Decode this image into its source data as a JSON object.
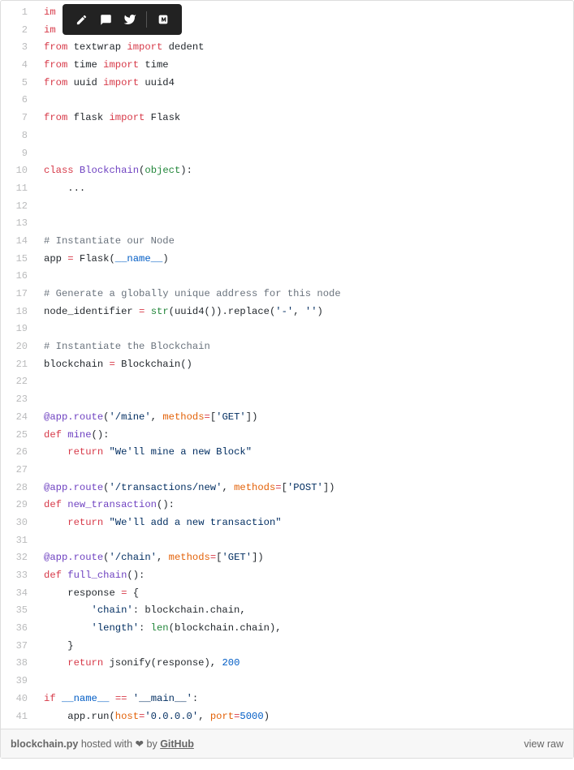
{
  "toolbar": {
    "icons": [
      "pencil-icon",
      "comment-icon",
      "twitter-icon",
      "medium-icon"
    ]
  },
  "code": [
    {
      "n": 1,
      "tokens": [
        [
          "kw",
          "im"
        ]
      ]
    },
    {
      "n": 2,
      "tokens": [
        [
          "kw",
          "im"
        ]
      ]
    },
    {
      "n": 3,
      "tokens": [
        [
          "kw",
          "from"
        ],
        [
          "nm",
          " textwrap "
        ],
        [
          "kw",
          "import"
        ],
        [
          "nm",
          " dedent"
        ]
      ]
    },
    {
      "n": 4,
      "tokens": [
        [
          "kw",
          "from"
        ],
        [
          "nm",
          " time "
        ],
        [
          "kw",
          "import"
        ],
        [
          "nm",
          " time"
        ]
      ]
    },
    {
      "n": 5,
      "tokens": [
        [
          "kw",
          "from"
        ],
        [
          "nm",
          " uuid "
        ],
        [
          "kw",
          "import"
        ],
        [
          "nm",
          " uuid4"
        ]
      ]
    },
    {
      "n": 6,
      "tokens": []
    },
    {
      "n": 7,
      "tokens": [
        [
          "kw",
          "from"
        ],
        [
          "nm",
          " flask "
        ],
        [
          "kw",
          "import"
        ],
        [
          "nm",
          " Flask"
        ]
      ]
    },
    {
      "n": 8,
      "tokens": []
    },
    {
      "n": 9,
      "tokens": []
    },
    {
      "n": 10,
      "tokens": [
        [
          "kw",
          "class"
        ],
        [
          "nm",
          " "
        ],
        [
          "fn",
          "Blockchain"
        ],
        [
          "nm",
          "("
        ],
        [
          "cls",
          "object"
        ],
        [
          "nm",
          "):"
        ]
      ]
    },
    {
      "n": 11,
      "tokens": [
        [
          "nm",
          "    ..."
        ]
      ]
    },
    {
      "n": 12,
      "tokens": []
    },
    {
      "n": 13,
      "tokens": []
    },
    {
      "n": 14,
      "tokens": [
        [
          "cmt",
          "# Instantiate our Node"
        ]
      ]
    },
    {
      "n": 15,
      "tokens": [
        [
          "nm",
          "app "
        ],
        [
          "op",
          "="
        ],
        [
          "nm",
          " Flask("
        ],
        [
          "const",
          "__name__"
        ],
        [
          "nm",
          ")"
        ]
      ]
    },
    {
      "n": 16,
      "tokens": []
    },
    {
      "n": 17,
      "tokens": [
        [
          "cmt",
          "# Generate a globally unique address for this node"
        ]
      ]
    },
    {
      "n": 18,
      "tokens": [
        [
          "nm",
          "node_identifier "
        ],
        [
          "op",
          "="
        ],
        [
          "nm",
          " "
        ],
        [
          "cls",
          "str"
        ],
        [
          "nm",
          "(uuid4()).replace("
        ],
        [
          "str",
          "'-'"
        ],
        [
          "nm",
          ", "
        ],
        [
          "str",
          "''"
        ],
        [
          "nm",
          ")"
        ]
      ]
    },
    {
      "n": 19,
      "tokens": []
    },
    {
      "n": 20,
      "tokens": [
        [
          "cmt",
          "# Instantiate the Blockchain"
        ]
      ]
    },
    {
      "n": 21,
      "tokens": [
        [
          "nm",
          "blockchain "
        ],
        [
          "op",
          "="
        ],
        [
          "nm",
          " Blockchain()"
        ]
      ]
    },
    {
      "n": 22,
      "tokens": []
    },
    {
      "n": 23,
      "tokens": []
    },
    {
      "n": 24,
      "tokens": [
        [
          "dec",
          "@app.route"
        ],
        [
          "nm",
          "("
        ],
        [
          "str",
          "'/mine'"
        ],
        [
          "nm",
          ", "
        ],
        [
          "decarg",
          "methods"
        ],
        [
          "op",
          "="
        ],
        [
          "nm",
          "["
        ],
        [
          "str",
          "'GET'"
        ],
        [
          "nm",
          "])"
        ]
      ]
    },
    {
      "n": 25,
      "tokens": [
        [
          "kw",
          "def"
        ],
        [
          "nm",
          " "
        ],
        [
          "fn",
          "mine"
        ],
        [
          "nm",
          "():"
        ]
      ]
    },
    {
      "n": 26,
      "tokens": [
        [
          "nm",
          "    "
        ],
        [
          "kw",
          "return"
        ],
        [
          "nm",
          " "
        ],
        [
          "str",
          "\"We'll mine a new Block\""
        ]
      ]
    },
    {
      "n": 27,
      "tokens": []
    },
    {
      "n": 28,
      "tokens": [
        [
          "dec",
          "@app.route"
        ],
        [
          "nm",
          "("
        ],
        [
          "str",
          "'/transactions/new'"
        ],
        [
          "nm",
          ", "
        ],
        [
          "decarg",
          "methods"
        ],
        [
          "op",
          "="
        ],
        [
          "nm",
          "["
        ],
        [
          "str",
          "'POST'"
        ],
        [
          "nm",
          "])"
        ]
      ]
    },
    {
      "n": 29,
      "tokens": [
        [
          "kw",
          "def"
        ],
        [
          "nm",
          " "
        ],
        [
          "fn",
          "new_transaction"
        ],
        [
          "nm",
          "():"
        ]
      ]
    },
    {
      "n": 30,
      "tokens": [
        [
          "nm",
          "    "
        ],
        [
          "kw",
          "return"
        ],
        [
          "nm",
          " "
        ],
        [
          "str",
          "\"We'll add a new transaction\""
        ]
      ]
    },
    {
      "n": 31,
      "tokens": []
    },
    {
      "n": 32,
      "tokens": [
        [
          "dec",
          "@app.route"
        ],
        [
          "nm",
          "("
        ],
        [
          "str",
          "'/chain'"
        ],
        [
          "nm",
          ", "
        ],
        [
          "decarg",
          "methods"
        ],
        [
          "op",
          "="
        ],
        [
          "nm",
          "["
        ],
        [
          "str",
          "'GET'"
        ],
        [
          "nm",
          "])"
        ]
      ]
    },
    {
      "n": 33,
      "tokens": [
        [
          "kw",
          "def"
        ],
        [
          "nm",
          " "
        ],
        [
          "fn",
          "full_chain"
        ],
        [
          "nm",
          "():"
        ]
      ]
    },
    {
      "n": 34,
      "tokens": [
        [
          "nm",
          "    response "
        ],
        [
          "op",
          "="
        ],
        [
          "nm",
          " {"
        ]
      ]
    },
    {
      "n": 35,
      "tokens": [
        [
          "nm",
          "        "
        ],
        [
          "str",
          "'chain'"
        ],
        [
          "nm",
          ": blockchain.chain,"
        ]
      ]
    },
    {
      "n": 36,
      "tokens": [
        [
          "nm",
          "        "
        ],
        [
          "str",
          "'length'"
        ],
        [
          "nm",
          ": "
        ],
        [
          "cls",
          "len"
        ],
        [
          "nm",
          "(blockchain.chain),"
        ]
      ]
    },
    {
      "n": 37,
      "tokens": [
        [
          "nm",
          "    }"
        ]
      ]
    },
    {
      "n": 38,
      "tokens": [
        [
          "nm",
          "    "
        ],
        [
          "kw",
          "return"
        ],
        [
          "nm",
          " jsonify(response), "
        ],
        [
          "num",
          "200"
        ]
      ]
    },
    {
      "n": 39,
      "tokens": []
    },
    {
      "n": 40,
      "tokens": [
        [
          "kw",
          "if"
        ],
        [
          "nm",
          " "
        ],
        [
          "const",
          "__name__"
        ],
        [
          "nm",
          " "
        ],
        [
          "op",
          "=="
        ],
        [
          "nm",
          " "
        ],
        [
          "str",
          "'__main__'"
        ],
        [
          "nm",
          ":"
        ]
      ]
    },
    {
      "n": 41,
      "tokens": [
        [
          "nm",
          "    app.run("
        ],
        [
          "decarg",
          "host"
        ],
        [
          "op",
          "="
        ],
        [
          "str",
          "'0.0.0.0'"
        ],
        [
          "nm",
          ", "
        ],
        [
          "decarg",
          "port"
        ],
        [
          "op",
          "="
        ],
        [
          "num",
          "5000"
        ],
        [
          "nm",
          ")"
        ]
      ]
    }
  ],
  "footer": {
    "filename": "blockchain.py",
    "hosted_prefix": " hosted with ",
    "heart": "❤",
    "by": " by ",
    "github": "GitHub",
    "view_raw": "view raw"
  }
}
